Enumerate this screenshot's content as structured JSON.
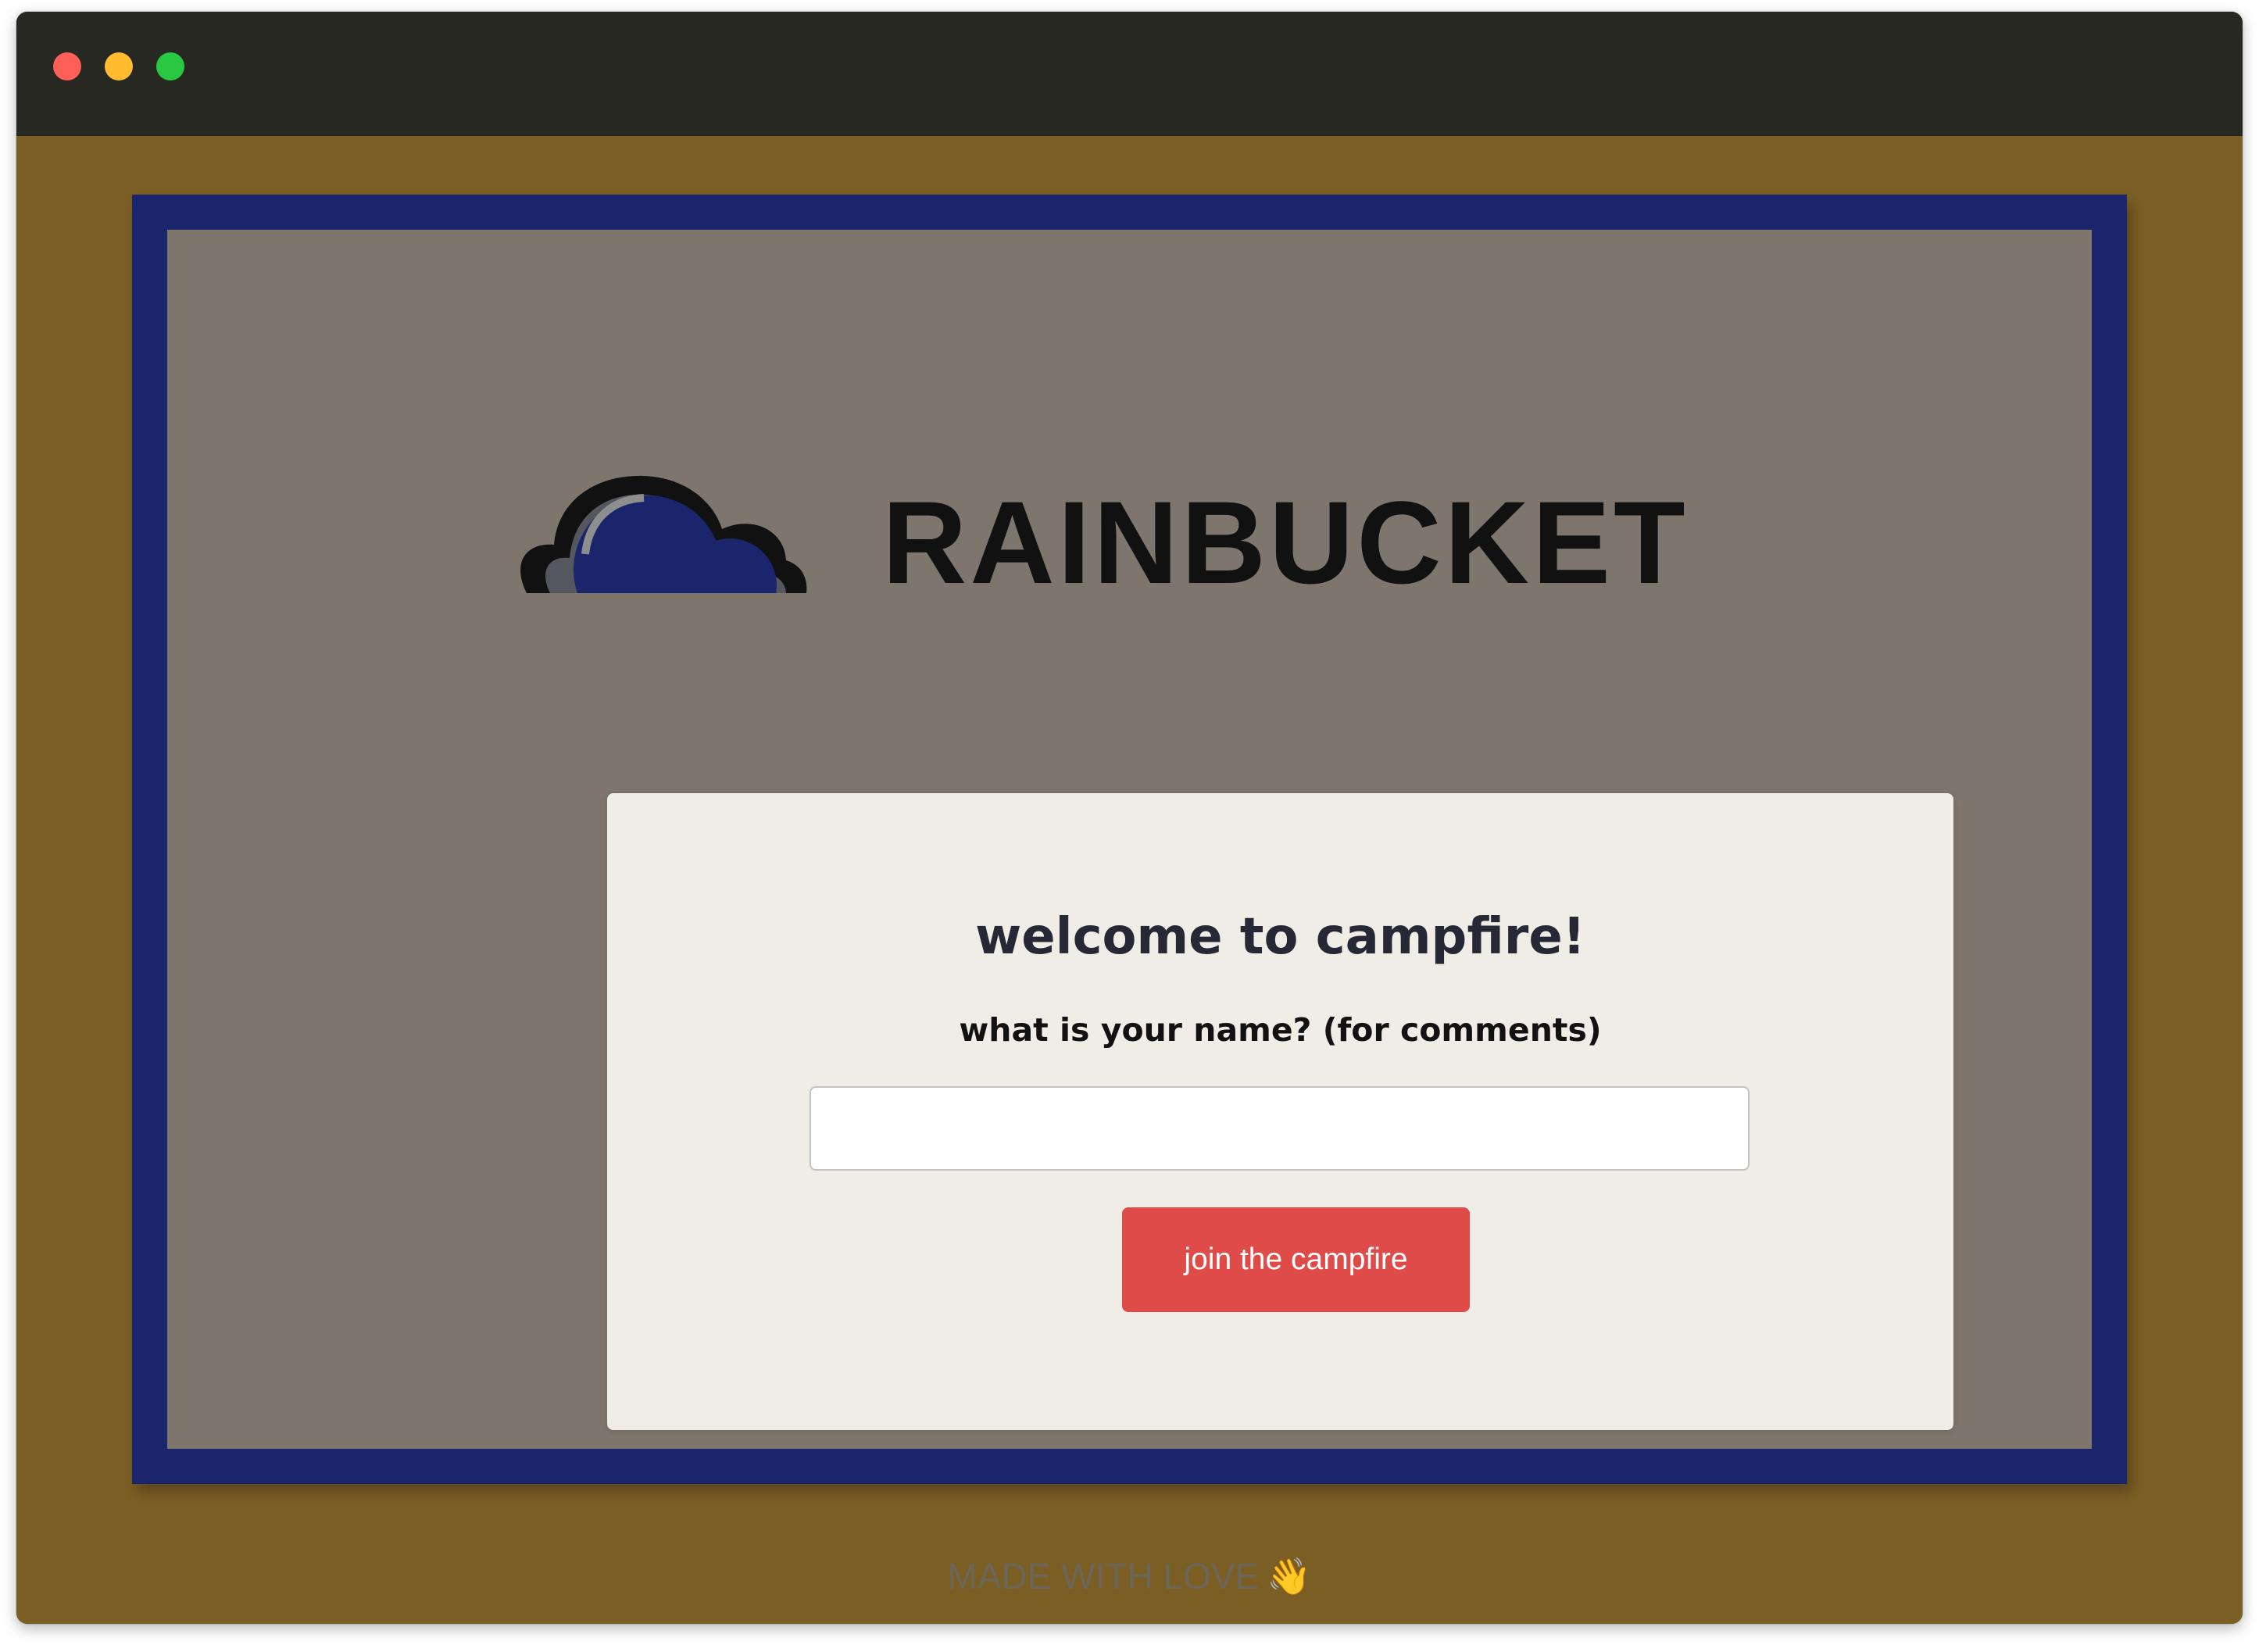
{
  "window": {
    "controls": [
      "close",
      "minimize",
      "zoom"
    ]
  },
  "logo": {
    "text": "RAINBUCKET",
    "icon": "cloud-icon"
  },
  "modal": {
    "title": "welcome to campfire!",
    "name_label": "what is your name? (for comments)",
    "name_input_value": "",
    "join_button_label": "join the campfire"
  },
  "footer": {
    "text": "MADE WITH LOVE",
    "emoji": "👋"
  },
  "colors": {
    "background": "#7b5e24",
    "frame": "#1b256b",
    "overlay": "#7e766c",
    "modal": "#efede6",
    "button": "#df4b48",
    "titlebar": "#282823"
  }
}
